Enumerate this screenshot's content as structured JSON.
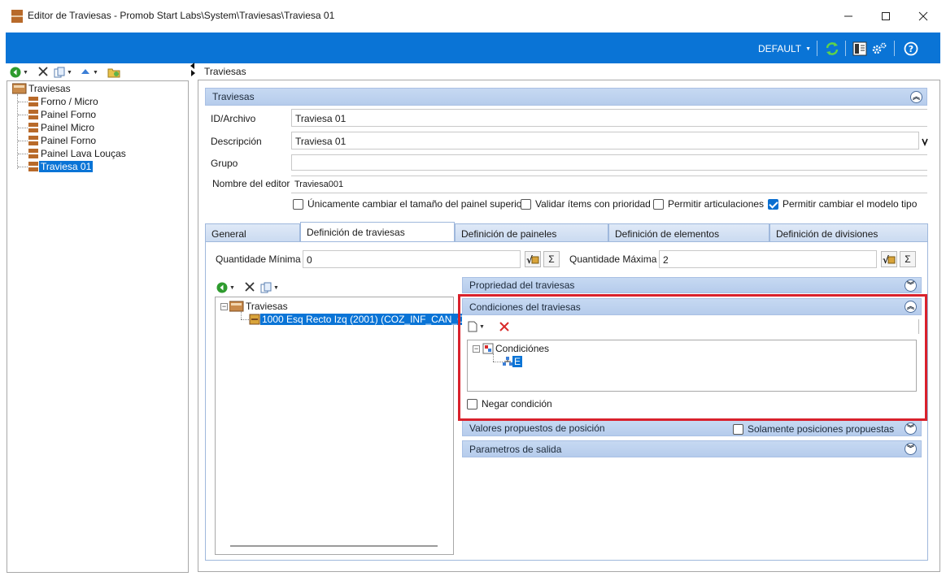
{
  "window": {
    "title": "Editor de Traviesas - Promob Start Labs\\System\\Traviesas\\Traviesa 01"
  },
  "toolbar": {
    "profile_label": "DEFAULT"
  },
  "left_tree": {
    "root": "Traviesas",
    "items": [
      {
        "label": "Forno / Micro"
      },
      {
        "label": "Painel Forno"
      },
      {
        "label": "Painel Micro"
      },
      {
        "label": "Painel Forno"
      },
      {
        "label": "Painel Lava Louças"
      },
      {
        "label": "Traviesa 01"
      }
    ]
  },
  "breadcrumb": "Traviesas",
  "section": {
    "title": "Traviesas",
    "fields": {
      "id_label": "ID/Archivo",
      "id_value": "Traviesa 01",
      "desc_label": "Descripción",
      "desc_value": "Traviesa 01",
      "group_label": "Grupo",
      "group_value": "",
      "editor_label": "Nombre del editor",
      "editor_value": "Traviesa001"
    },
    "checkboxes": [
      {
        "label": "Únicamente cambiar el tamaño del painel superior",
        "checked": false
      },
      {
        "label": "Validar ítems con prioridad",
        "checked": false
      },
      {
        "label": "Permitir articulaciones",
        "checked": false
      },
      {
        "label": "Permitir cambiar el modelo tipo",
        "checked": true
      }
    ]
  },
  "tabs": [
    {
      "label": "General"
    },
    {
      "label": "Definición de traviesas"
    },
    {
      "label": "Definición de paineles"
    },
    {
      "label": "Definición de elementos"
    },
    {
      "label": "Definición de divisiones"
    }
  ],
  "quantities": {
    "min_label": "Quantidade Mínima",
    "min_value": "0",
    "max_label": "Quantidade Máxima",
    "max_value": "2",
    "sigma": "Σ"
  },
  "inner_tree": {
    "root": "Traviesas",
    "item": "1000 Esq Recto Izq (2001) (COZ_INF_CAN_C"
  },
  "panels": {
    "propiedad": "Propriedad del traviesas",
    "condiciones": "Condiciones del traviesas",
    "valores": "Valores propuestos de posición",
    "solamente": "Solamente posiciones propuestas",
    "parametros": "Parametros de salida"
  },
  "conditions": {
    "root": "Condiciónes",
    "item": "E",
    "negar": "Negar condición"
  },
  "colors": {
    "accent": "#0a74d6",
    "highlight_border": "#d9212c",
    "group_bar": "#c6d9f2"
  }
}
